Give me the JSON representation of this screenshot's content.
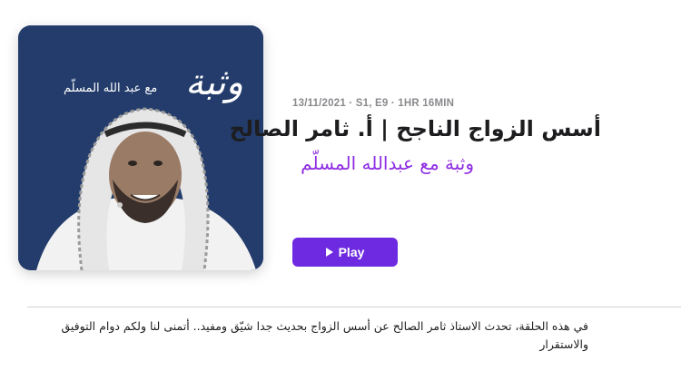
{
  "episode": {
    "artwork": {
      "byline": "مع عبد الله المسلّم",
      "title": "وثبة"
    },
    "meta": "13/11/2021 · S1, E9 · 1HR 16MIN",
    "title": "أسس الزواج الناجح | أ. ثامر الصالح",
    "show_name": "وثبة مع عبدالله المسلّم",
    "play_label": "Play",
    "description": "في هذه الحلقة، تحدث الاستاذ ثامر الصالح عن أسس الزواج بحديث جدا شيّق ومفيد.. أتمنى لنا ولكم دوام التوفيق والاستقرار"
  },
  "colors": {
    "accent": "#6d2ae0",
    "show_name": "#8e2de2",
    "artwork_bg": "#233c6b"
  },
  "icons": {
    "play": "play-icon"
  }
}
